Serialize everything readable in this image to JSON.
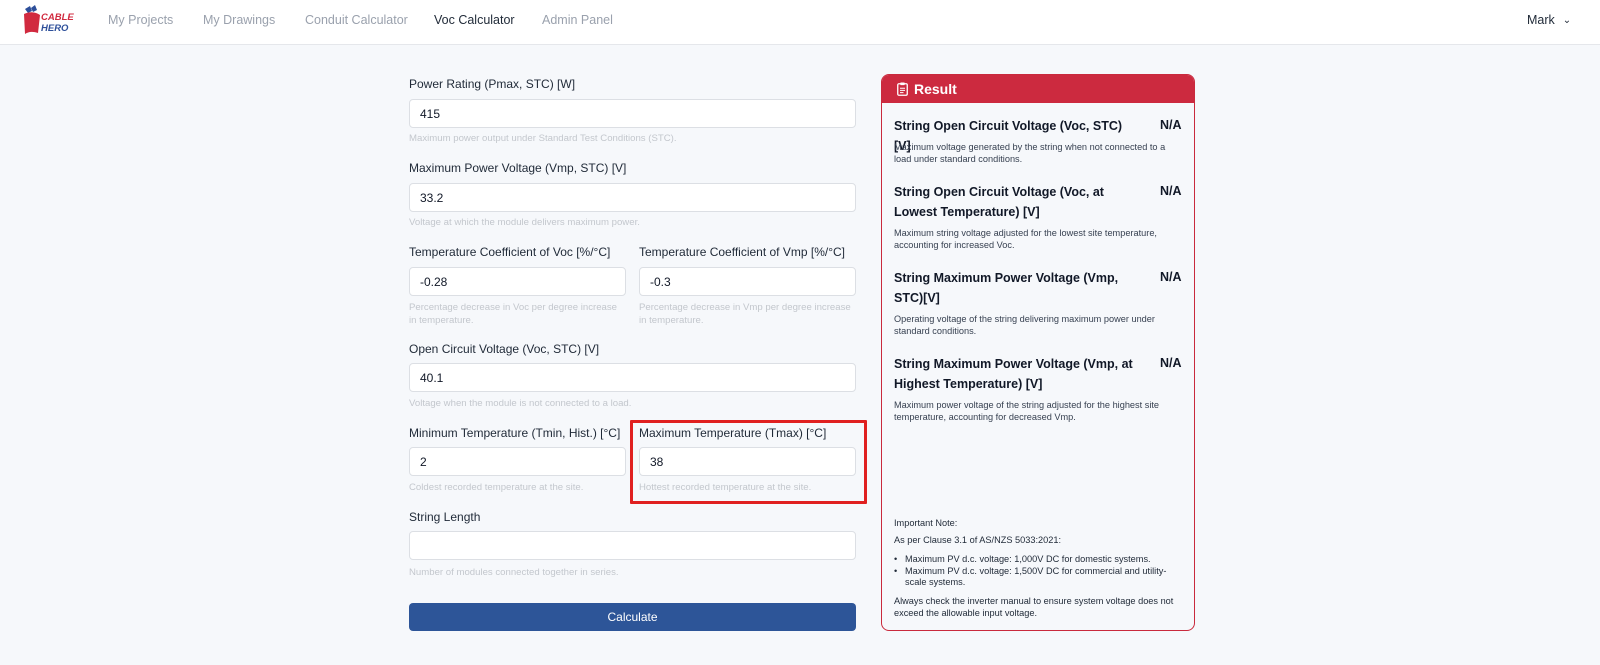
{
  "nav": {
    "logo_text_1": "CABLE",
    "logo_text_2": "HERO",
    "links": [
      "My Projects",
      "My Drawings",
      "Conduit Calculator",
      "Voc Calculator",
      "Admin Panel"
    ],
    "active": "Voc Calculator",
    "user": "Mark",
    "user_icon": "chevron-down-icon"
  },
  "form": {
    "pmax": {
      "label": "Power Rating (Pmax, STC) [W]",
      "value": "415",
      "help": "Maximum power output under Standard Test Conditions (STC)."
    },
    "vmp": {
      "label": "Maximum Power Voltage (Vmp, STC) [V]",
      "value": "33.2",
      "help": "Voltage at which the module delivers maximum power."
    },
    "tc_voc": {
      "label": "Temperature Coefficient of Voc [%/°C]",
      "value": "-0.28",
      "help": "Percentage decrease in Voc per degree increase in temperature."
    },
    "tc_vmp": {
      "label": "Temperature Coefficient of Vmp [%/°C]",
      "value": "-0.3",
      "help": "Percentage decrease in Vmp per degree increase in temperature."
    },
    "voc": {
      "label": "Open Circuit Voltage (Voc, STC) [V]",
      "value": "40.1",
      "help": "Voltage when the module is not connected to a load."
    },
    "tmin": {
      "label": "Minimum Temperature (Tmin, Hist.) [°C]",
      "value": "2",
      "help": "Coldest recorded temperature at the site."
    },
    "tmax": {
      "label": "Maximum Temperature (Tmax) [°C]",
      "value": "38",
      "help": "Hottest recorded temperature at the site."
    },
    "string_length": {
      "label": "String Length",
      "value": "",
      "help": "Number of modules connected together in series."
    },
    "calculate_label": "Calculate"
  },
  "result": {
    "title": "Result",
    "icon": "clipboard-icon",
    "items": [
      {
        "title": "String Open Circuit Voltage (Voc, STC)[V]",
        "value": "N/A",
        "desc": "Maximum voltage generated by the string when not connected to a load under standard conditions."
      },
      {
        "title": "String Open Circuit Voltage (Voc, at Lowest Temperature) [V]",
        "value": "N/A",
        "desc": "Maximum string voltage adjusted for the lowest site temperature, accounting for increased Voc."
      },
      {
        "title": "String Maximum Power Voltage (Vmp, STC)[V]",
        "value": "N/A",
        "desc": "Operating voltage of the string delivering maximum power under standard conditions."
      },
      {
        "title": "String Maximum Power Voltage (Vmp, at Highest Temperature) [V]",
        "value": "N/A",
        "desc": "Maximum power voltage of the string adjusted for the highest site temperature, accounting for decreased Vmp."
      }
    ],
    "note_heading": "Important Note:",
    "note_clause": "As per Clause 3.1 of AS/NZS 5033:2021:",
    "note_bullets": [
      "Maximum PV d.c. voltage: 1,000V DC for domestic systems.",
      "Maximum PV d.c. voltage: 1,500V DC for commercial and utility-scale systems."
    ],
    "note_footer": "Always check the inverter manual to ensure system voltage does not exceed the allowable input voltage."
  },
  "colors": {
    "accent_red": "#cc2a3f",
    "button_blue": "#2d5598",
    "highlight_red": "#e02020"
  }
}
